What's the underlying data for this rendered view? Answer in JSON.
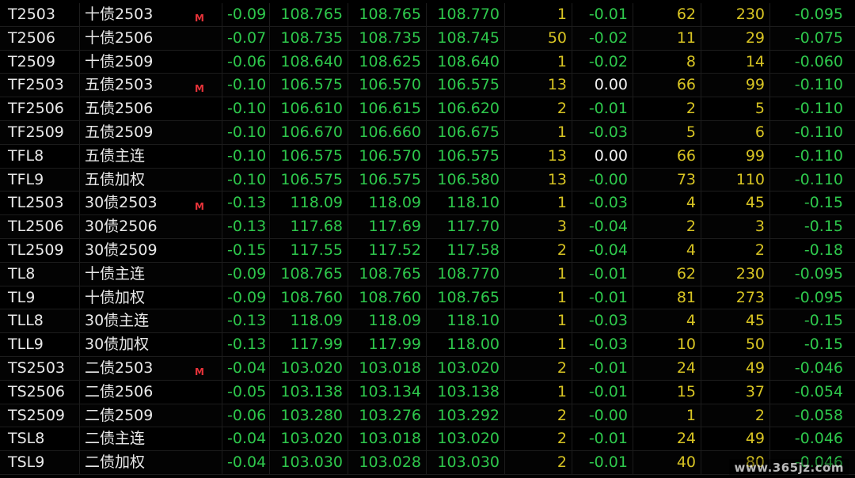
{
  "colors": {
    "background": "#000000",
    "up_green": "#2ec84c",
    "volume_yellow": "#d8c423",
    "flat_white": "#f2f2f2",
    "text": "#e9e9e9",
    "flag_red": "#e8333a"
  },
  "rows": [
    {
      "code": "T2503",
      "name": "十债2503",
      "flag": "M",
      "chg": "-0.09",
      "last": "108.765",
      "bid": "108.765",
      "ask": "108.770",
      "vol": "1",
      "d2": "-0.01",
      "n1": "62",
      "n2": "230",
      "pct": "-0.095"
    },
    {
      "code": "T2506",
      "name": "十债2506",
      "flag": "",
      "chg": "-0.07",
      "last": "108.735",
      "bid": "108.735",
      "ask": "108.745",
      "vol": "50",
      "d2": "-0.02",
      "n1": "11",
      "n2": "29",
      "pct": "-0.075"
    },
    {
      "code": "T2509",
      "name": "十债2509",
      "flag": "",
      "chg": "-0.06",
      "last": "108.640",
      "bid": "108.625",
      "ask": "108.640",
      "vol": "1",
      "d2": "-0.02",
      "n1": "8",
      "n2": "14",
      "pct": "-0.060"
    },
    {
      "code": "TF2503",
      "name": "五债2503",
      "flag": "M",
      "chg": "-0.10",
      "last": "106.575",
      "bid": "106.570",
      "ask": "106.575",
      "vol": "13",
      "d2": "0.00",
      "n1": "66",
      "n2": "99",
      "pct": "-0.110"
    },
    {
      "code": "TF2506",
      "name": "五债2506",
      "flag": "",
      "chg": "-0.10",
      "last": "106.610",
      "bid": "106.615",
      "ask": "106.620",
      "vol": "2",
      "d2": "-0.01",
      "n1": "2",
      "n2": "5",
      "pct": "-0.110"
    },
    {
      "code": "TF2509",
      "name": "五债2509",
      "flag": "",
      "chg": "-0.10",
      "last": "106.670",
      "bid": "106.660",
      "ask": "106.675",
      "vol": "1",
      "d2": "-0.03",
      "n1": "5",
      "n2": "6",
      "pct": "-0.110"
    },
    {
      "code": "TFL8",
      "name": "五债主连",
      "flag": "",
      "chg": "-0.10",
      "last": "106.575",
      "bid": "106.570",
      "ask": "106.575",
      "vol": "13",
      "d2": "0.00",
      "n1": "66",
      "n2": "99",
      "pct": "-0.110"
    },
    {
      "code": "TFL9",
      "name": "五债加权",
      "flag": "",
      "chg": "-0.10",
      "last": "106.575",
      "bid": "106.575",
      "ask": "106.580",
      "vol": "13",
      "d2": "-0.00",
      "n1": "73",
      "n2": "110",
      "pct": "-0.110"
    },
    {
      "code": "TL2503",
      "name": "30债2503",
      "flag": "M",
      "chg": "-0.13",
      "last": "118.09",
      "bid": "118.09",
      "ask": "118.10",
      "vol": "1",
      "d2": "-0.03",
      "n1": "4",
      "n2": "45",
      "pct": "-0.15"
    },
    {
      "code": "TL2506",
      "name": "30债2506",
      "flag": "",
      "chg": "-0.13",
      "last": "117.68",
      "bid": "117.69",
      "ask": "117.70",
      "vol": "3",
      "d2": "-0.04",
      "n1": "2",
      "n2": "3",
      "pct": "-0.15"
    },
    {
      "code": "TL2509",
      "name": "30债2509",
      "flag": "",
      "chg": "-0.15",
      "last": "117.55",
      "bid": "117.52",
      "ask": "117.58",
      "vol": "2",
      "d2": "-0.04",
      "n1": "4",
      "n2": "2",
      "pct": "-0.18"
    },
    {
      "code": "TL8",
      "name": "十债主连",
      "flag": "",
      "chg": "-0.09",
      "last": "108.765",
      "bid": "108.765",
      "ask": "108.770",
      "vol": "1",
      "d2": "-0.01",
      "n1": "62",
      "n2": "230",
      "pct": "-0.095"
    },
    {
      "code": "TL9",
      "name": "十债加权",
      "flag": "",
      "chg": "-0.09",
      "last": "108.760",
      "bid": "108.760",
      "ask": "108.765",
      "vol": "1",
      "d2": "-0.01",
      "n1": "81",
      "n2": "273",
      "pct": "-0.095"
    },
    {
      "code": "TLL8",
      "name": "30债主连",
      "flag": "",
      "chg": "-0.13",
      "last": "118.09",
      "bid": "118.09",
      "ask": "118.10",
      "vol": "1",
      "d2": "-0.03",
      "n1": "4",
      "n2": "45",
      "pct": "-0.15"
    },
    {
      "code": "TLL9",
      "name": "30债加权",
      "flag": "",
      "chg": "-0.13",
      "last": "117.99",
      "bid": "117.99",
      "ask": "118.00",
      "vol": "1",
      "d2": "-0.03",
      "n1": "10",
      "n2": "50",
      "pct": "-0.15"
    },
    {
      "code": "TS2503",
      "name": "二债2503",
      "flag": "M",
      "chg": "-0.04",
      "last": "103.020",
      "bid": "103.018",
      "ask": "103.020",
      "vol": "2",
      "d2": "-0.01",
      "n1": "24",
      "n2": "49",
      "pct": "-0.046"
    },
    {
      "code": "TS2506",
      "name": "二债2506",
      "flag": "",
      "chg": "-0.05",
      "last": "103.138",
      "bid": "103.134",
      "ask": "103.138",
      "vol": "1",
      "d2": "-0.01",
      "n1": "15",
      "n2": "37",
      "pct": "-0.054"
    },
    {
      "code": "TS2509",
      "name": "二债2509",
      "flag": "",
      "chg": "-0.06",
      "last": "103.280",
      "bid": "103.276",
      "ask": "103.292",
      "vol": "2",
      "d2": "-0.00",
      "n1": "1",
      "n2": "2",
      "pct": "-0.058"
    },
    {
      "code": "TSL8",
      "name": "二债主连",
      "flag": "",
      "chg": "-0.04",
      "last": "103.020",
      "bid": "103.018",
      "ask": "103.020",
      "vol": "2",
      "d2": "-0.01",
      "n1": "24",
      "n2": "49",
      "pct": "-0.046"
    },
    {
      "code": "TSL9",
      "name": "二债加权",
      "flag": "",
      "chg": "-0.04",
      "last": "103.030",
      "bid": "103.028",
      "ask": "103.030",
      "vol": "2",
      "d2": "-0.01",
      "n1": "40",
      "n2": "80",
      "pct": "-0.046"
    }
  ],
  "watermark": "www.365jz.com"
}
